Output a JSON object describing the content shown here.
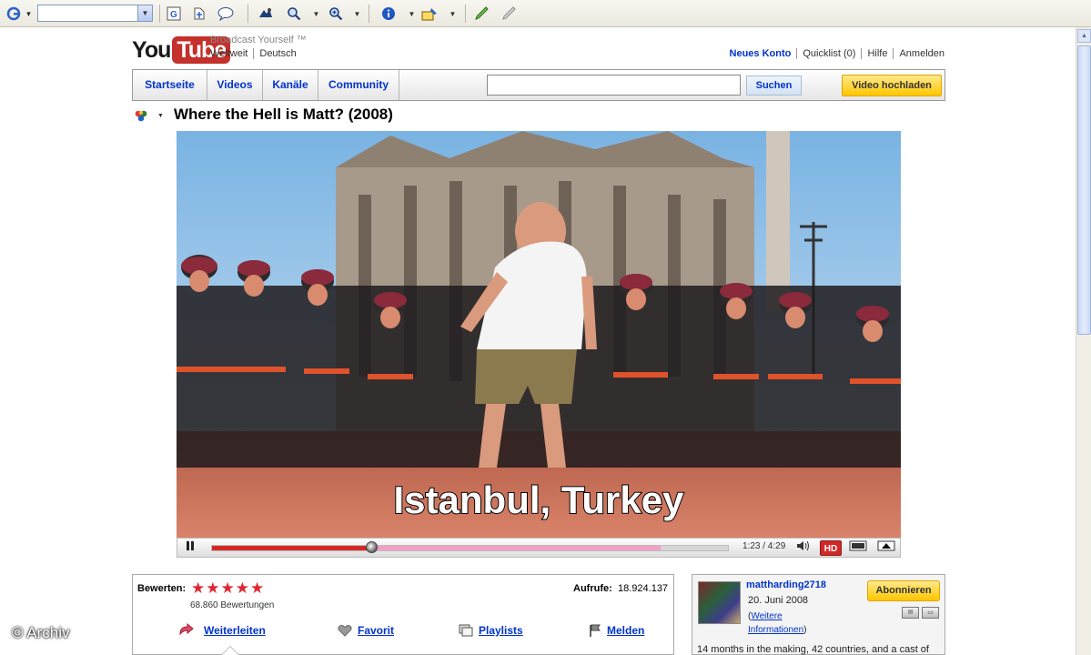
{
  "browser_toolbar": {
    "items": [
      {
        "name": "google-icon",
        "glyph": "g"
      },
      {
        "name": "check-page-icon",
        "glyph": "G"
      },
      {
        "name": "translate-icon",
        "glyph": "字"
      },
      {
        "name": "comment-icon",
        "glyph": "🗪"
      },
      {
        "name": "pointer-icon",
        "glyph": "✦"
      },
      {
        "name": "zoom-icon",
        "glyph": "🔍"
      },
      {
        "name": "zoom-plus-icon",
        "glyph": "🔎"
      },
      {
        "name": "info-icon",
        "glyph": "ℹ"
      },
      {
        "name": "highlight-icon",
        "glyph": "✎"
      },
      {
        "name": "pen-icon",
        "glyph": "✏"
      },
      {
        "name": "eraser-icon",
        "glyph": "╱"
      }
    ]
  },
  "header": {
    "logo_you": "You",
    "logo_tube": "Tube",
    "tagline": "Broadcast Yourself ™",
    "locale": [
      "Weltweit",
      "Deutsch"
    ],
    "account_links": [
      "Neues Konto",
      "Quicklist (0)",
      "Hilfe",
      "Anmelden"
    ]
  },
  "navbar": {
    "tabs": [
      "Startseite",
      "Videos",
      "Kanäle",
      "Community"
    ],
    "search_value": "",
    "search_button": "Suchen",
    "upload_button": "Video hochladen"
  },
  "video": {
    "title": "Where the Hell is Matt? (2008)",
    "subtitle": "Istanbul, Turkey",
    "time": "1:23 / 4:29",
    "played_fraction": 0.31,
    "loaded_fraction": 0.87,
    "hd_label": "HD"
  },
  "info": {
    "rate_label": "Bewerten:",
    "stars": 5,
    "ratings_count": "68.860 Bewertungen",
    "views_label": "Aufrufe:",
    "views_value": "18.924.137",
    "actions": [
      "Weiterleiten",
      "Favorit",
      "Playlists",
      "Melden"
    ]
  },
  "channel": {
    "username": "mattharding2718",
    "joined": "20. Juni 2008",
    "more_info_prefix": "(",
    "more_info_link": "Weitere Informationen",
    "more_info_suffix": ")",
    "subscribe": "Abonnieren",
    "description": "14 months in the making, 42 countries, and a cast of"
  },
  "watermark": "© Archiv",
  "colors": {
    "link": "#0033cc",
    "brand_red": "#c4302b",
    "button_yellow": "#ffc600",
    "progress_red": "#d42828"
  }
}
